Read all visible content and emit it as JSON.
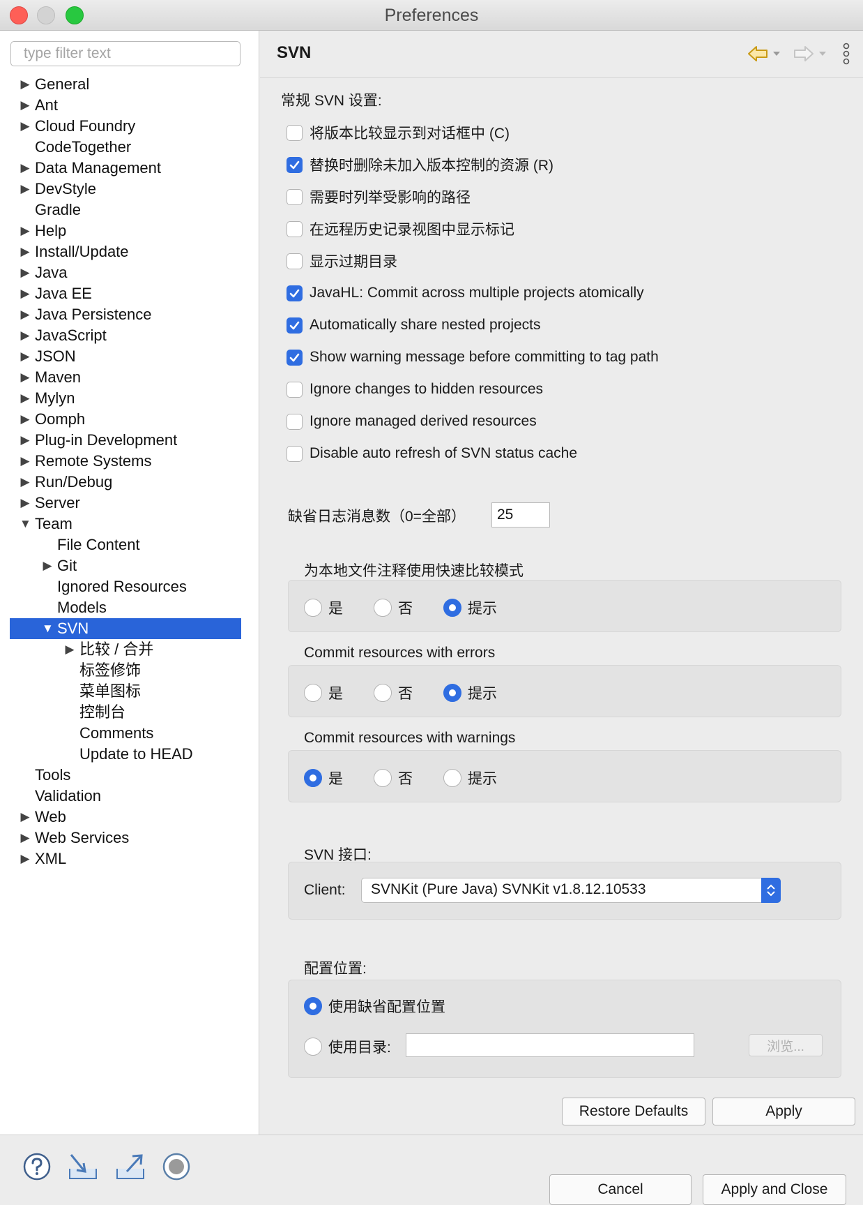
{
  "window": {
    "title": "Preferences"
  },
  "sidebar": {
    "filter_placeholder": "type filter text",
    "items": [
      {
        "label": "General",
        "arrow": "▶",
        "level": 0
      },
      {
        "label": "Ant",
        "arrow": "▶",
        "level": 0
      },
      {
        "label": "Cloud Foundry",
        "arrow": "▶",
        "level": 0
      },
      {
        "label": "CodeTogether",
        "arrow": "",
        "level": 0
      },
      {
        "label": "Data Management",
        "arrow": "▶",
        "level": 0
      },
      {
        "label": "DevStyle",
        "arrow": "▶",
        "level": 0
      },
      {
        "label": "Gradle",
        "arrow": "",
        "level": 0
      },
      {
        "label": "Help",
        "arrow": "▶",
        "level": 0
      },
      {
        "label": "Install/Update",
        "arrow": "▶",
        "level": 0
      },
      {
        "label": "Java",
        "arrow": "▶",
        "level": 0
      },
      {
        "label": "Java EE",
        "arrow": "▶",
        "level": 0
      },
      {
        "label": "Java Persistence",
        "arrow": "▶",
        "level": 0
      },
      {
        "label": "JavaScript",
        "arrow": "▶",
        "level": 0
      },
      {
        "label": "JSON",
        "arrow": "▶",
        "level": 0
      },
      {
        "label": "Maven",
        "arrow": "▶",
        "level": 0
      },
      {
        "label": "Mylyn",
        "arrow": "▶",
        "level": 0
      },
      {
        "label": "Oomph",
        "arrow": "▶",
        "level": 0
      },
      {
        "label": "Plug-in Development",
        "arrow": "▶",
        "level": 0
      },
      {
        "label": "Remote Systems",
        "arrow": "▶",
        "level": 0
      },
      {
        "label": "Run/Debug",
        "arrow": "▶",
        "level": 0
      },
      {
        "label": "Server",
        "arrow": "▶",
        "level": 0
      },
      {
        "label": "Team",
        "arrow": "▼",
        "level": 0
      },
      {
        "label": "File Content",
        "arrow": "",
        "level": 1
      },
      {
        "label": "Git",
        "arrow": "▶",
        "level": 1
      },
      {
        "label": "Ignored Resources",
        "arrow": "",
        "level": 1
      },
      {
        "label": "Models",
        "arrow": "",
        "level": 1
      },
      {
        "label": "SVN",
        "arrow": "▼",
        "level": 1,
        "selected": true
      },
      {
        "label": "比较 / 合并",
        "arrow": "▶",
        "level": 2
      },
      {
        "label": "标签修饰",
        "arrow": "",
        "level": 2
      },
      {
        "label": "菜单图标",
        "arrow": "",
        "level": 2
      },
      {
        "label": "控制台",
        "arrow": "",
        "level": 2
      },
      {
        "label": "Comments",
        "arrow": "",
        "level": 2
      },
      {
        "label": "Update to HEAD",
        "arrow": "",
        "level": 2
      },
      {
        "label": "Tools",
        "arrow": "",
        "level": 0
      },
      {
        "label": "Validation",
        "arrow": "",
        "level": 0
      },
      {
        "label": "Web",
        "arrow": "▶",
        "level": 0
      },
      {
        "label": "Web Services",
        "arrow": "▶",
        "level": 0
      },
      {
        "label": "XML",
        "arrow": "▶",
        "level": 0
      }
    ]
  },
  "page": {
    "title": "SVN",
    "general_heading": "常规 SVN 设置:",
    "checkboxes": [
      {
        "label": "将版本比较显示到对话框中 (C)",
        "checked": false
      },
      {
        "label": "替换时删除未加入版本控制的资源 (R)",
        "checked": true
      },
      {
        "label": "需要时列举受影响的路径",
        "checked": false
      },
      {
        "label": "在远程历史记录视图中显示标记",
        "checked": false
      },
      {
        "label": "显示过期目录",
        "checked": false
      },
      {
        "label": "JavaHL: Commit across multiple projects atomically",
        "checked": true
      },
      {
        "label": "Automatically share nested projects",
        "checked": true
      },
      {
        "label": "Show warning message before committing to tag path",
        "checked": true
      },
      {
        "label": "Ignore changes to hidden resources",
        "checked": false
      },
      {
        "label": "Ignore managed derived resources",
        "checked": false
      },
      {
        "label": "Disable auto refresh of SVN status cache",
        "checked": false
      }
    ],
    "log_messages": {
      "label": "缺省日志消息数（0=全部）",
      "value": "25"
    },
    "radio_groups": [
      {
        "title": "为本地文件注释使用快速比较模式",
        "options": [
          "是",
          "否",
          "提示"
        ],
        "selected": 2
      },
      {
        "title": "Commit resources with errors",
        "options": [
          "是",
          "否",
          "提示"
        ],
        "selected": 2
      },
      {
        "title": "Commit resources with warnings",
        "options": [
          "是",
          "否",
          "提示"
        ],
        "selected": 0
      }
    ],
    "interface": {
      "title": "SVN 接口:",
      "client_label": "Client:",
      "client_value": "SVNKit (Pure Java) SVNKit v1.8.12.10533"
    },
    "config": {
      "title": "配置位置:",
      "default_label": "使用缺省配置位置",
      "dir_label": "使用目录:",
      "dir_value": "",
      "browse_label": "浏览...",
      "selected": 0
    },
    "restore_defaults": "Restore Defaults",
    "apply": "Apply"
  },
  "footer": {
    "cancel": "Cancel",
    "apply_close": "Apply and Close",
    "icons": [
      "help-icon",
      "import-icon",
      "export-icon",
      "record-icon"
    ]
  },
  "colors": {
    "accent": "#2f6de1",
    "selection": "#2964d9",
    "nav_back": "#c99a15"
  }
}
